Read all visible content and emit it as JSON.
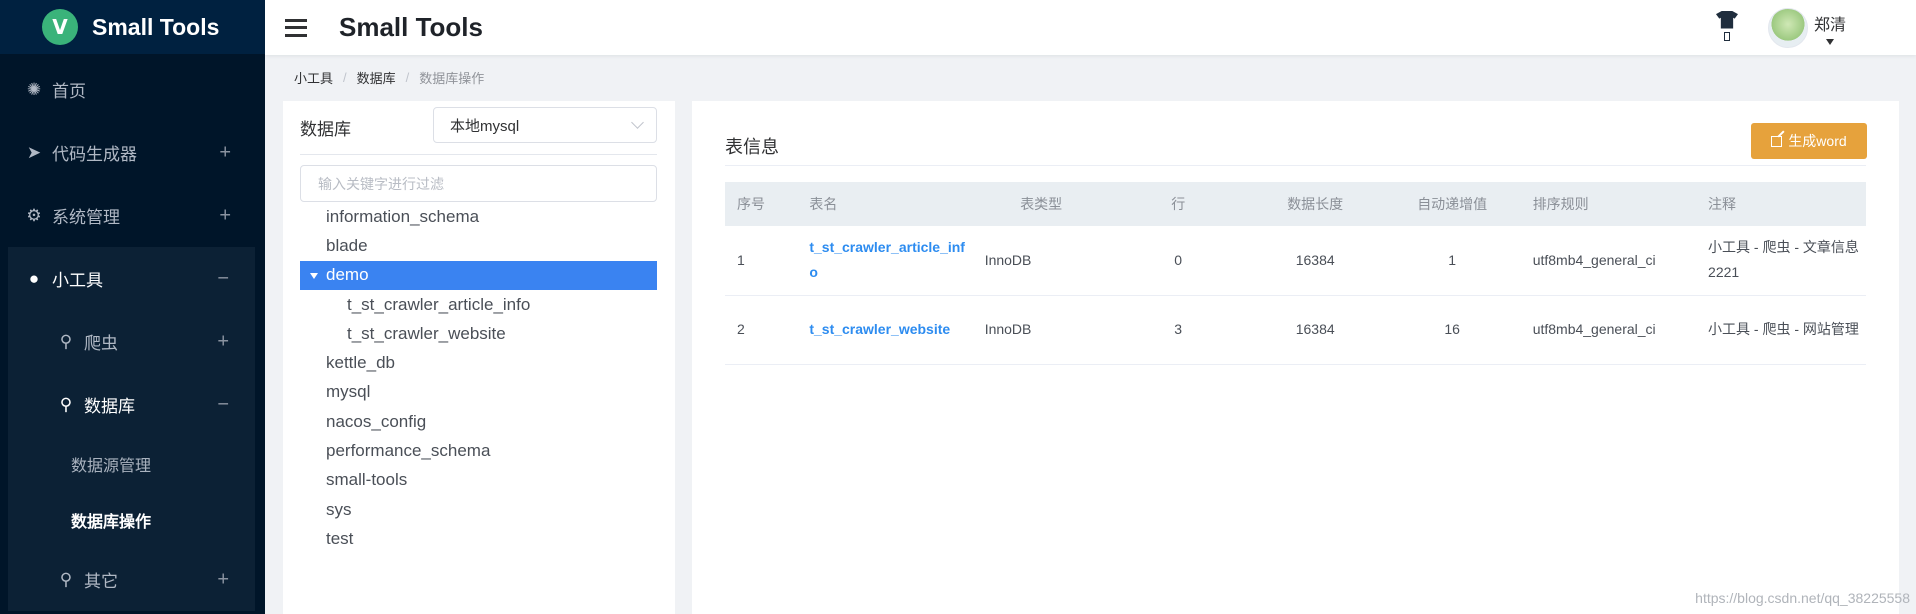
{
  "app": {
    "logo_letter": "V",
    "name": "Small Tools"
  },
  "header": {
    "title": "Small Tools",
    "user_name": "郑清"
  },
  "sidebar": {
    "items": [
      {
        "label": "首页",
        "icon": "loading-icon"
      },
      {
        "label": "代码生成器",
        "icon": "send-icon",
        "toggle": "+"
      },
      {
        "label": "系统管理",
        "icon": "gear-icon",
        "toggle": "+"
      },
      {
        "label": "小工具",
        "icon": "bulb-icon",
        "toggle": "−"
      }
    ],
    "sub": [
      {
        "label": "爬虫",
        "icon": "search-icon",
        "toggle": "+"
      },
      {
        "label": "数据库",
        "icon": "search-icon",
        "toggle": "−"
      }
    ],
    "leaves": [
      {
        "label": "数据源管理"
      },
      {
        "label": "数据库操作"
      }
    ],
    "other": {
      "label": "其它",
      "icon": "search-icon",
      "toggle": "+"
    }
  },
  "breadcrumb": {
    "items": [
      "小工具",
      "数据库",
      "数据库操作"
    ],
    "sep": "/"
  },
  "left": {
    "db_label": "数据库",
    "db_selected": "本地mysql",
    "filter_placeholder": "输入关键字进行过滤",
    "tree": [
      {
        "label": "information_schema",
        "level": 0
      },
      {
        "label": "blade",
        "level": 0
      },
      {
        "label": "demo",
        "level": 0,
        "expanded": true,
        "selected": true
      },
      {
        "label": "t_st_crawler_article_info",
        "level": 1
      },
      {
        "label": "t_st_crawler_website",
        "level": 1
      },
      {
        "label": "kettle_db",
        "level": 0
      },
      {
        "label": "mysql",
        "level": 0
      },
      {
        "label": "nacos_config",
        "level": 0
      },
      {
        "label": "performance_schema",
        "level": 0
      },
      {
        "label": "small-tools",
        "level": 0
      },
      {
        "label": "sys",
        "level": 0
      },
      {
        "label": "test",
        "level": 0
      }
    ]
  },
  "right": {
    "title": "表信息",
    "generate_label": "生成word",
    "columns": [
      "序号",
      "表名",
      "表类型",
      "行",
      "数据长度",
      "自动递增值",
      "排序规则",
      "注释"
    ],
    "rows": [
      [
        "1",
        "t_st_crawler_article_info",
        "InnoDB",
        "0",
        "16384",
        "1",
        "utf8mb4_general_ci",
        "小工具 - 爬虫 - 文章信息2221"
      ],
      [
        "2",
        "t_st_crawler_website",
        "InnoDB",
        "3",
        "16384",
        "16",
        "utf8mb4_general_ci",
        "小工具 - 爬虫 - 网站管理"
      ]
    ]
  },
  "watermark": "https://blog.csdn.net/qq_38225558"
}
